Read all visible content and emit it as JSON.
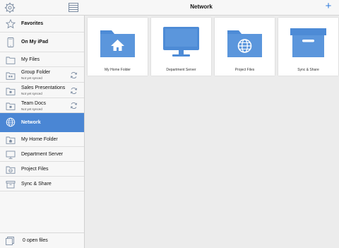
{
  "header": {
    "title": "Network",
    "settings_icon": "gear-icon",
    "view_icon": "list-view-icon",
    "add_icon": "plus-icon",
    "accent": "#2f7bdc"
  },
  "sidebar": {
    "favorites": "Favorites",
    "on_my_ipad": "On My iPad",
    "my_files": "My Files",
    "group_folder": {
      "label": "Group Folder",
      "status": "Not yet synced"
    },
    "sales_presentations": {
      "label": "Sales Presentations",
      "status": "Not yet synced"
    },
    "team_docs": {
      "label": "Team Docs",
      "status": "Not yet synced"
    },
    "network": "Network",
    "network_items": [
      "My Home Folder",
      "Department Server",
      "Project Files",
      "Sync & Share"
    ],
    "selected_color": "#4a86d4"
  },
  "footer": {
    "open_files": "0 open files"
  },
  "main": {
    "tiles": [
      {
        "label": "My Home Folder",
        "icon": "home-folder-icon"
      },
      {
        "label": "Department Server",
        "icon": "monitor-icon"
      },
      {
        "label": "Project Files",
        "icon": "globe-folder-icon"
      },
      {
        "label": "Sync & Share",
        "icon": "archive-box-icon"
      }
    ],
    "icon_color": "#4d8bd6"
  }
}
